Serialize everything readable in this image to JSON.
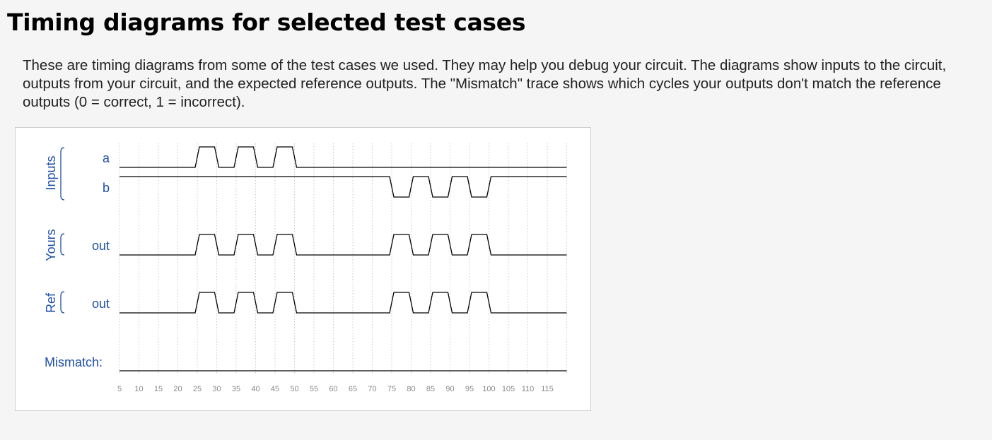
{
  "page": {
    "title": "Timing diagrams for selected test cases",
    "intro": "These are timing diagrams from some of the test cases we used. They may help you debug your circuit. The diagrams show inputs to the circuit, outputs from your circuit, and the expected reference outputs. The \"Mismatch\" trace shows which cycles your outputs don't match the reference outputs (0 = correct, 1 = incorrect)."
  },
  "diagram": {
    "groups": [
      {
        "label": "Inputs",
        "signals": [
          "a",
          "b"
        ]
      },
      {
        "label": "Yours",
        "signals": [
          "out"
        ]
      },
      {
        "label": "Ref",
        "signals": [
          "out"
        ]
      }
    ],
    "mismatch_label": "Mismatch:",
    "ticks": [
      "5",
      "10",
      "15",
      "20",
      "25",
      "30",
      "35",
      "40",
      "45",
      "50",
      "55",
      "60",
      "65",
      "70",
      "75",
      "80",
      "85",
      "90",
      "95",
      "100",
      "105",
      "110",
      "115"
    ],
    "time_start": 5,
    "time_end": 120,
    "colors": {
      "label": "#1f4fa8",
      "wave": "#000000",
      "grid": "#bdbdbd",
      "tick": "#888888"
    },
    "traces": [
      {
        "name": "a",
        "group": "Inputs",
        "initial": 0,
        "transitions": [
          [
            25,
            1
          ],
          [
            30,
            0
          ],
          [
            35,
            1
          ],
          [
            40,
            0
          ],
          [
            45,
            1
          ],
          [
            50,
            0
          ]
        ]
      },
      {
        "name": "b",
        "group": "Inputs",
        "initial": 1,
        "transitions": [
          [
            75,
            0
          ],
          [
            80,
            1
          ],
          [
            85,
            0
          ],
          [
            90,
            1
          ],
          [
            95,
            0
          ],
          [
            100,
            1
          ]
        ]
      },
      {
        "name": "out",
        "group": "Yours",
        "initial": 0,
        "transitions": [
          [
            25,
            1
          ],
          [
            30,
            0
          ],
          [
            35,
            1
          ],
          [
            40,
            0
          ],
          [
            45,
            1
          ],
          [
            50,
            0
          ],
          [
            75,
            1
          ],
          [
            80,
            0
          ],
          [
            85,
            1
          ],
          [
            90,
            0
          ],
          [
            95,
            1
          ],
          [
            100,
            0
          ]
        ]
      },
      {
        "name": "out",
        "group": "Ref",
        "initial": 0,
        "transitions": [
          [
            25,
            1
          ],
          [
            30,
            0
          ],
          [
            35,
            1
          ],
          [
            40,
            0
          ],
          [
            45,
            1
          ],
          [
            50,
            0
          ],
          [
            75,
            1
          ],
          [
            80,
            0
          ],
          [
            85,
            1
          ],
          [
            90,
            0
          ],
          [
            95,
            1
          ],
          [
            100,
            0
          ]
        ]
      },
      {
        "name": "Mismatch",
        "group": "Mismatch",
        "initial": 0,
        "transitions": []
      }
    ]
  }
}
